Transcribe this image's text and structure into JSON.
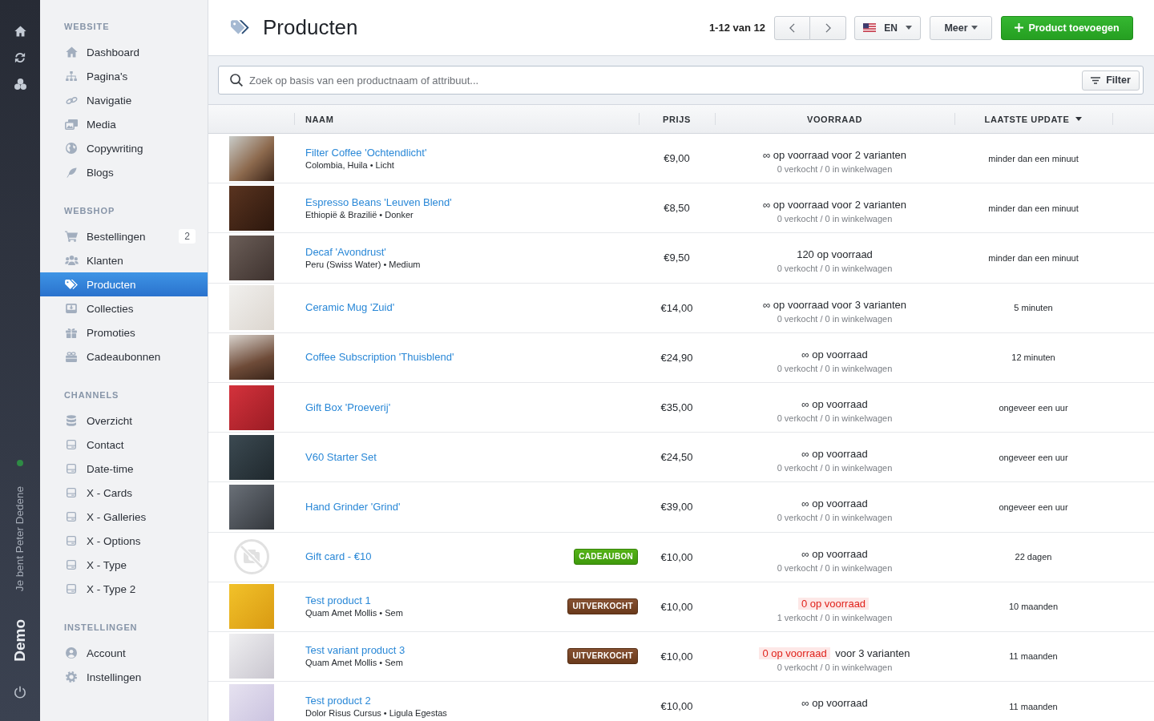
{
  "rail": {
    "online": true,
    "user": "Je bent Peter Dedene",
    "brand": "Demo"
  },
  "sidebar": {
    "sections": [
      {
        "title": "WEBSITE",
        "items": [
          {
            "label": "Dashboard",
            "selected": false
          },
          {
            "label": "Pagina's",
            "selected": false
          },
          {
            "label": "Navigatie",
            "selected": false
          },
          {
            "label": "Media",
            "selected": false
          },
          {
            "label": "Copywriting",
            "selected": false
          },
          {
            "label": "Blogs",
            "selected": false
          }
        ]
      },
      {
        "title": "WEBSHOP",
        "items": [
          {
            "label": "Bestellingen",
            "selected": false,
            "count": "2"
          },
          {
            "label": "Klanten",
            "selected": false
          },
          {
            "label": "Producten",
            "selected": true
          },
          {
            "label": "Collecties",
            "selected": false
          },
          {
            "label": "Promoties",
            "selected": false
          },
          {
            "label": "Cadeaubonnen",
            "selected": false
          }
        ]
      },
      {
        "title": "CHANNELS",
        "items": [
          {
            "label": "Overzicht",
            "selected": false
          },
          {
            "label": "Contact",
            "selected": false
          },
          {
            "label": "Date-time",
            "selected": false
          },
          {
            "label": "X - Cards",
            "selected": false
          },
          {
            "label": "X - Galleries",
            "selected": false
          },
          {
            "label": "X - Options",
            "selected": false
          },
          {
            "label": "X - Type",
            "selected": false
          },
          {
            "label": "X - Type 2",
            "selected": false
          }
        ]
      },
      {
        "title": "INSTELLINGEN",
        "items": [
          {
            "label": "Account",
            "selected": false
          },
          {
            "label": "Instellingen",
            "selected": false
          }
        ]
      }
    ]
  },
  "header": {
    "title": "Producten",
    "pagination": "1-12 van 12",
    "language": "EN",
    "more_button": "Meer",
    "add_button": "Product toevoegen"
  },
  "search": {
    "placeholder": "Zoek op basis van een productnaam of attribuut...",
    "filter_button": "Filter"
  },
  "table": {
    "columns": [
      {
        "label": "NAAM",
        "sorted": false
      },
      {
        "label": "PRIJS",
        "sorted": false
      },
      {
        "label": "VOORRAAD",
        "sorted": false
      },
      {
        "label": "LAATSTE UPDATE",
        "sorted": true
      }
    ],
    "rows": [
      {
        "kind": "photo",
        "name": "Filter Coffee 'Ochtendlicht'",
        "details": "Colombia, Huila • Licht",
        "price": "€9,00",
        "stock": "∞ op voorraad",
        "variants": "voor 2 varianten",
        "out_of_stock": false,
        "sales": "0 verkocht / 0 in winkelwagen",
        "updated": "minder dan een minuut"
      },
      {
        "kind": "photo",
        "name": "Espresso Beans 'Leuven Blend'",
        "details": "Ethiopië & Brazilië • Donker",
        "price": "€8,50",
        "stock": "∞ op voorraad",
        "variants": "voor 2 varianten",
        "out_of_stock": false,
        "sales": "0 verkocht / 0 in winkelwagen",
        "updated": "minder dan een minuut"
      },
      {
        "kind": "photo",
        "name": "Decaf 'Avondrust'",
        "details": "Peru (Swiss Water) • Medium",
        "price": "€9,50",
        "stock": "120 op voorraad",
        "out_of_stock": false,
        "sales": "0 verkocht / 0 in winkelwagen",
        "updated": "minder dan een minuut"
      },
      {
        "kind": "photo",
        "name": "Ceramic Mug 'Zuid'",
        "price": "€14,00",
        "stock": "∞ op voorraad",
        "variants": "voor 3 varianten",
        "out_of_stock": false,
        "sales": "0 verkocht / 0 in winkelwagen",
        "updated": "5 minuten"
      },
      {
        "kind": "photo",
        "name": "Coffee Subscription 'Thuisblend'",
        "price": "€24,90",
        "stock": "∞ op voorraad",
        "out_of_stock": false,
        "sales": "0 verkocht / 0 in winkelwagen",
        "updated": "12 minuten"
      },
      {
        "kind": "photo",
        "name": "Gift Box 'Proeverij'",
        "price": "€35,00",
        "stock": "∞ op voorraad",
        "out_of_stock": false,
        "sales": "0 verkocht / 0 in winkelwagen",
        "updated": "ongeveer een uur"
      },
      {
        "kind": "photo",
        "name": "V60 Starter Set",
        "price": "€24,50",
        "stock": "∞ op voorraad",
        "out_of_stock": false,
        "sales": "0 verkocht / 0 in winkelwagen",
        "updated": "ongeveer een uur"
      },
      {
        "kind": "photo",
        "name": "Hand Grinder 'Grind'",
        "price": "€39,00",
        "stock": "∞ op voorraad",
        "out_of_stock": false,
        "sales": "0 verkocht / 0 in winkelwagen",
        "updated": "ongeveer een uur"
      },
      {
        "kind": "no_image",
        "name": "Gift card - €10",
        "badge": {
          "label": "CADEAUBON",
          "kind": "gift"
        },
        "price": "€10,00",
        "stock": "∞ op voorraad",
        "out_of_stock": false,
        "sales": "0 verkocht / 0 in winkelwagen",
        "updated": "22 dagen"
      },
      {
        "kind": "photo",
        "name": "Test product 1",
        "details": "Quam Amet Mollis • Sem",
        "badge": {
          "label": "UITVERKOCHT",
          "kind": "soldout"
        },
        "price": "€10,00",
        "stock": "0 op voorraad",
        "out_of_stock": true,
        "sales": "1 verkocht / 0 in winkelwagen",
        "updated": "10 maanden"
      },
      {
        "kind": "photo",
        "name": "Test variant product 3",
        "details": "Quam Amet Mollis • Sem",
        "badge": {
          "label": "UITVERKOCHT",
          "kind": "soldout"
        },
        "price": "€10,00",
        "stock": "0 op voorraad",
        "variants": "voor 3 varianten",
        "out_of_stock": true,
        "sales": "0 verkocht / 0 in winkelwagen",
        "updated": "11 maanden"
      },
      {
        "kind": "photo",
        "name": "Test product 2",
        "details": "Dolor Risus Cursus • Ligula Egestas",
        "price": "€10,00",
        "stock": "∞ op voorraad",
        "out_of_stock": false,
        "updated": "11 maanden"
      }
    ]
  }
}
